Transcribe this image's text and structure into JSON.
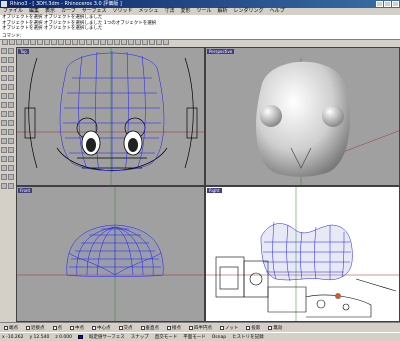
{
  "titlebar": {
    "title": "Rhino3 - [ 3DH.3dm - Rhinoceros 3.0 評価版 ]"
  },
  "menu": [
    "ファイル",
    "編集",
    "表示",
    "カーブ",
    "サーフェス",
    "ソリッド",
    "メッシュ",
    "寸法",
    "変形",
    "ツール",
    "解析",
    "レンダリング",
    "ヘルプ"
  ],
  "command_history": [
    "オブジェクトを選択 オブジェクトを選択しました",
    "オブジェクトを選択 オブジェクトを選択しました 1つのオブジェクトを選択",
    "オブジェクトを選択 オブジェクトを選択しました",
    "オブジェクトを選択 オブジェクトを選択しました 1つのオブジェクトを選択"
  ],
  "command_prompt": "コマンド:",
  "viewports": {
    "top": "Top",
    "perspective": "Perspective",
    "front": "Front",
    "right": "Right"
  },
  "osnaps": [
    "端点",
    "近接点",
    "点",
    "中点",
    "中心点",
    "交点",
    "垂直点",
    "接点",
    "四半円点",
    "ノット",
    "投影",
    "無効"
  ],
  "status": {
    "x": "x -10.262",
    "y": "y 12.540",
    "z": "z 0.000",
    "layer": "既定値サーフェス",
    "items": [
      "スナップ",
      "直交モード",
      "平面モード",
      "Osnap",
      "ヒストリを記録"
    ]
  },
  "colors": {
    "mesh": "#1a1aff",
    "viewport_bg": "#a0a0a0",
    "title_bg": "#0a246a"
  }
}
